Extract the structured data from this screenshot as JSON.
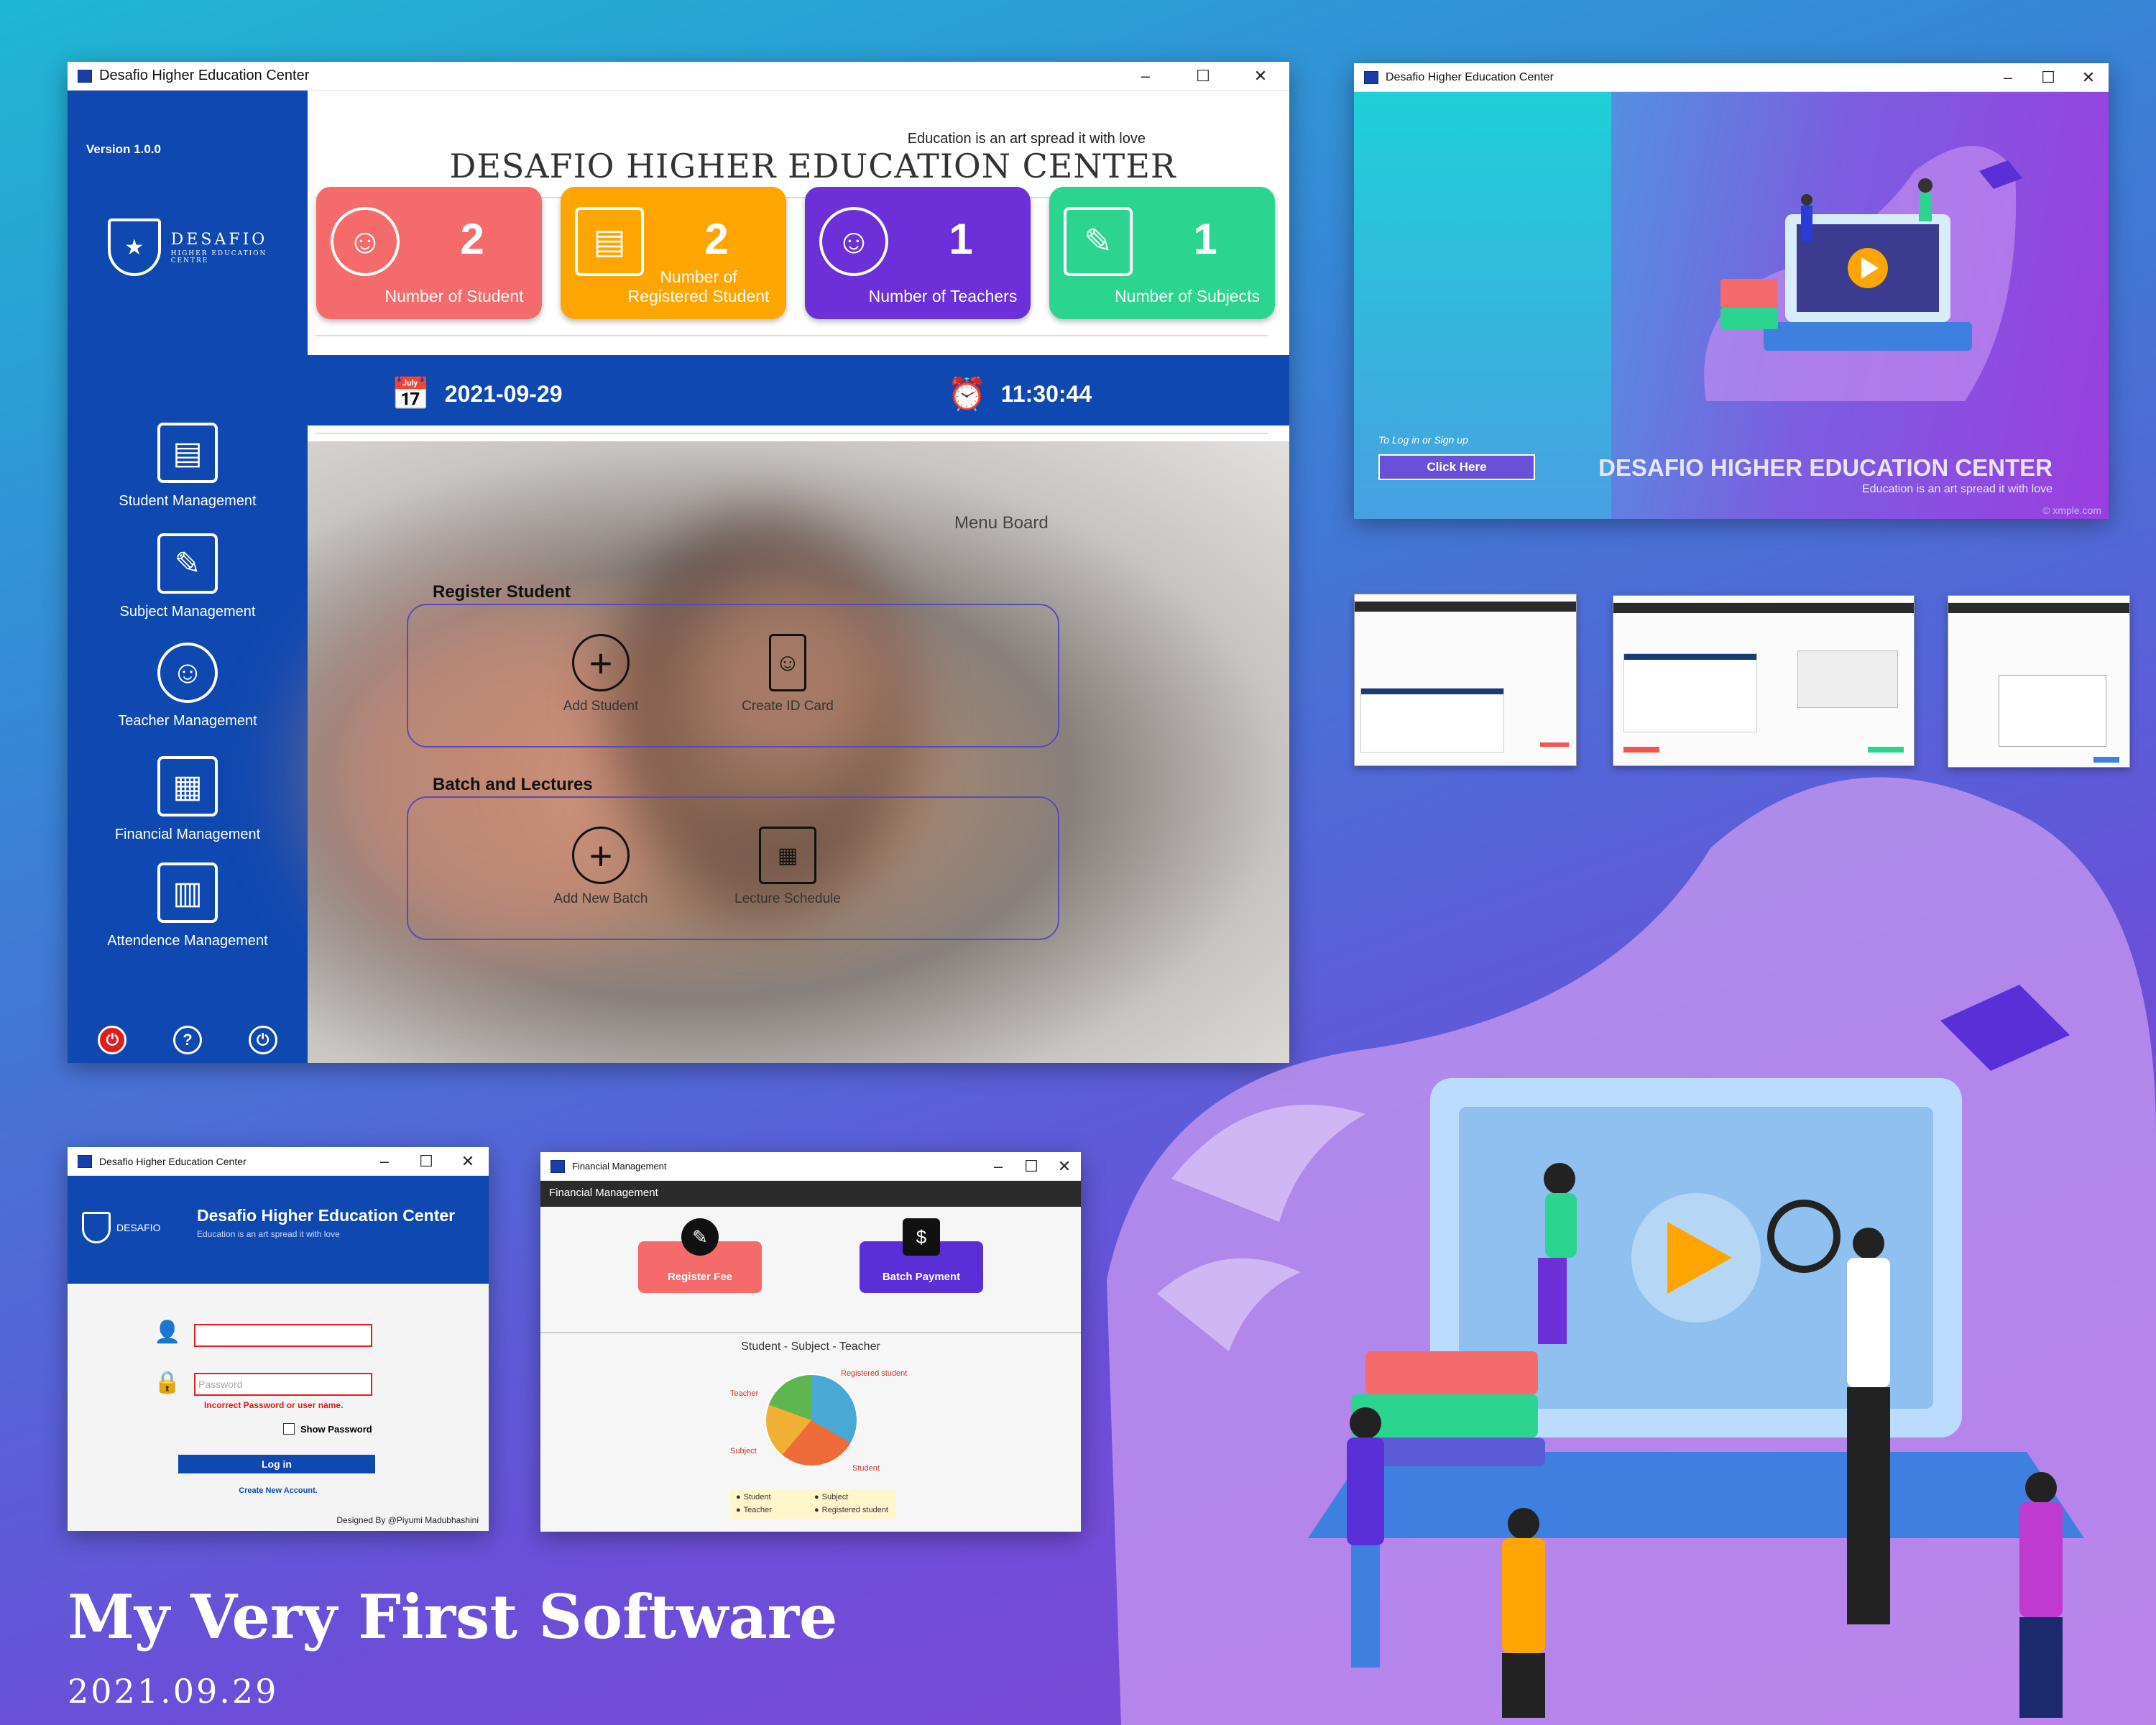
{
  "main_window": {
    "title": "Desafio Higher Education Center",
    "controls": [
      "–",
      "☐",
      "✕"
    ],
    "sidebar": {
      "version": "Version 1.0.0",
      "brand": "DESAFIO",
      "brand_sub": "HIGHER EDUCATION CENTRE",
      "items": [
        {
          "label": "Student Management",
          "icon": "id-card-icon"
        },
        {
          "label": "Subject Management",
          "icon": "notebook-icon"
        },
        {
          "label": "Teacher Management",
          "icon": "teacher-icon"
        },
        {
          "label": "Financial Management",
          "icon": "calculator-icon"
        },
        {
          "label": "Attendence Management",
          "icon": "calendar-icon"
        }
      ],
      "bottom_icons": [
        "power-icon",
        "help-icon",
        "logout-icon"
      ]
    },
    "tagline": "Education is an art spread it with love",
    "heading": "DESAFIO HIGHER EDUCATION CENTER",
    "stat_cards": [
      {
        "value": "2",
        "label": "Number of Student",
        "color": "#f56a6a",
        "icon": "student-icon"
      },
      {
        "value": "2",
        "label": "Number of  Registered Student",
        "color": "#ffa502",
        "icon": "registration-icon"
      },
      {
        "value": "1",
        "label": "Number of Teachers",
        "color": "#6c2fd8",
        "icon": "teacher-icon"
      },
      {
        "value": "1",
        "label": "Number of Subjects",
        "color": "#2bd48f",
        "icon": "book-icon"
      }
    ],
    "date": "2021-09-29",
    "time": "11:30:44",
    "menu_board": {
      "title": "Menu Board",
      "sections": [
        {
          "heading": "Register Student",
          "items": [
            {
              "label": "Add Student",
              "icon": "plus-circle-icon"
            },
            {
              "label": "Create ID Card",
              "icon": "id-badge-icon"
            }
          ]
        },
        {
          "heading": "Batch and Lectures",
          "items": [
            {
              "label": "Add New Batch",
              "icon": "plus-circle-icon"
            },
            {
              "label": "Lecture Schedule",
              "icon": "schedule-board-icon"
            }
          ]
        }
      ]
    }
  },
  "welcome_window": {
    "title": "Desafio Higher Education Center",
    "hint": "To Log in or Sign up",
    "button": "Click Here",
    "heading": "DESAFIO HIGHER EDUCATION CENTER",
    "tagline": "Education is an art spread it with love",
    "watermark": "© xmple.com"
  },
  "login_window": {
    "title": "Desafio Higher Education Center",
    "brand": "DESAFIO",
    "heading": "Desafio Higher Education Center",
    "tagline": "Education is an art spread it with love",
    "username_value": "",
    "password_placeholder": "Password",
    "error": "Incorrect Password or user name.",
    "show_password": "Show Password",
    "login_button": "Log in",
    "create_link": "Create New Account.",
    "designer": "Designed By @Piyumi Madubhashini"
  },
  "financial_window": {
    "title": "Financial Management",
    "header": "Financial Management",
    "buttons": [
      {
        "label": "Register Fee",
        "color": "#f56a6a"
      },
      {
        "label": "Batch Payment",
        "color": "#5b2fd8"
      }
    ],
    "chart_title": "Student - Subject - Teacher",
    "chart_data": {
      "type": "pie",
      "categories": [
        "Registered student",
        "Student",
        "Subject",
        "Teacher"
      ],
      "legend": [
        "Student",
        "Subject",
        "Teacher",
        "Registered student"
      ]
    }
  },
  "footer": {
    "title": "My Very First Software",
    "date": "2021.09.29"
  }
}
